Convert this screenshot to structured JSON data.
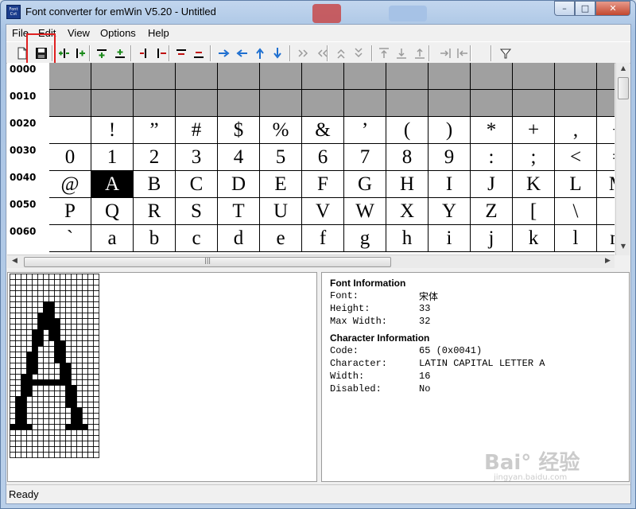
{
  "window": {
    "title": "Font converter for emWin V5.20 - Untitled",
    "app_icon_text": "Font Cvt",
    "minimize": "–",
    "maximize": "□",
    "close": "✕"
  },
  "menu": [
    "File",
    "Edit",
    "View",
    "Options",
    "Help"
  ],
  "toolbar": {
    "icons": [
      "new-icon",
      "save-icon",
      "add-col-left-icon",
      "add-col-right-icon",
      "add-row-top-icon",
      "add-row-bottom-icon",
      "del-col-left-icon",
      "del-col-right-icon",
      "del-row-top-icon",
      "del-row-bottom-icon",
      "shift-right-icon",
      "shift-left-icon",
      "shift-up-icon",
      "shift-down-icon",
      "move-right-icon",
      "move-left-icon",
      "move-up-icon",
      "move-down-icon",
      "align-top-icon",
      "align-bottom-icon",
      "align-up-icon",
      "align-right-icon",
      "align-left-icon",
      "filter-icon"
    ]
  },
  "grid": {
    "row_labels": [
      "0000",
      "0010",
      "0020",
      "0030",
      "0040",
      "0050",
      "0060"
    ],
    "rows": [
      [
        "",
        "",
        "",
        "",
        "",
        "",
        "",
        "",
        "",
        "",
        "",
        "",
        "",
        ""
      ],
      [
        "",
        "",
        "",
        "",
        "",
        "",
        "",
        "",
        "",
        "",
        "",
        "",
        "",
        ""
      ],
      [
        "",
        "!",
        "”",
        "#",
        "$",
        "%",
        "&",
        "’",
        "(",
        ")",
        "*",
        "+",
        ",",
        "−"
      ],
      [
        "0",
        "1",
        "2",
        "3",
        "4",
        "5",
        "6",
        "7",
        "8",
        "9",
        ":",
        ";",
        "<",
        "="
      ],
      [
        "@",
        "A",
        "B",
        "C",
        "D",
        "E",
        "F",
        "G",
        "H",
        "I",
        "J",
        "K",
        "L",
        "M"
      ],
      [
        "P",
        "Q",
        "R",
        "S",
        "T",
        "U",
        "V",
        "W",
        "X",
        "Y",
        "Z",
        "[",
        "\\",
        "]"
      ],
      [
        "`",
        "a",
        "b",
        "c",
        "d",
        "e",
        "f",
        "g",
        "h",
        "i",
        "j",
        "k",
        "l",
        "m"
      ]
    ],
    "gray_rows": [
      0,
      1
    ],
    "selected": {
      "row": 4,
      "col": 1
    }
  },
  "glyph": {
    "character": "A",
    "columns": 16,
    "rows": 33
  },
  "font_info": {
    "heading": "Font Information",
    "font_key": "Font:",
    "font_val": "宋体",
    "height_key": "Height:",
    "height_val": "33",
    "maxwidth_key": "Max Width:",
    "maxwidth_val": "32"
  },
  "char_info": {
    "heading": "Character Information",
    "code_key": "Code:",
    "code_val": "65 (0x0041)",
    "char_key": "Character:",
    "char_val": "LATIN CAPITAL LETTER A",
    "width_key": "Width:",
    "width_val": "16",
    "disabled_key": "Disabled:",
    "disabled_val": "No"
  },
  "status": "Ready",
  "watermark": "Bai° 经验",
  "watermark_url": "jingyan.baidu.com",
  "colors": {
    "highlight": "#e02020",
    "grid_gray": "#a0a0a0",
    "selected": "#000000"
  }
}
